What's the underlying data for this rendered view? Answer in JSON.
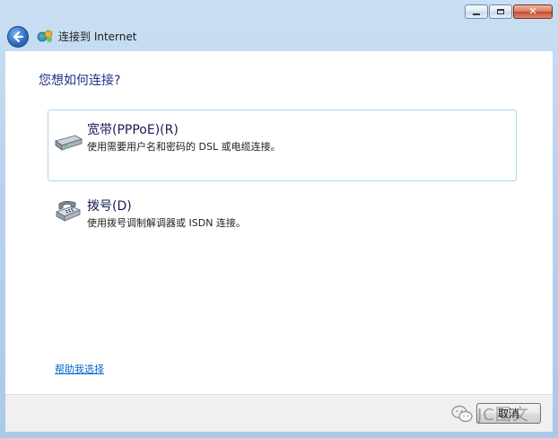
{
  "window": {
    "title": "连接到 Internet",
    "controls": {
      "minimize_icon": "minimize-icon",
      "maximize_icon": "maximize-icon",
      "close_icon": "close-icon"
    }
  },
  "header": {
    "back_icon": "back-arrow-icon",
    "app_icon": "network-icon"
  },
  "main": {
    "question": "您想如何连接?",
    "options": [
      {
        "title": "宽带(PPPoE)(R)",
        "description": "使用需要用户名和密码的 DSL 或电缆连接。",
        "icon": "broadband-modem-icon",
        "selected": true
      },
      {
        "title": "拨号(D)",
        "description": "使用拨号调制解调器或 ISDN 连接。",
        "icon": "dialup-phone-icon",
        "selected": false
      }
    ],
    "help_link": "帮助我选择"
  },
  "footer": {
    "cancel_label": "取消",
    "watermark_text": "JC图文",
    "watermark_icon": "wechat-icon"
  },
  "colors": {
    "frame": "#b9d3ee",
    "question_text": "#1e3287",
    "selected_border": "#a6d7ec",
    "link": "#0066cc"
  }
}
